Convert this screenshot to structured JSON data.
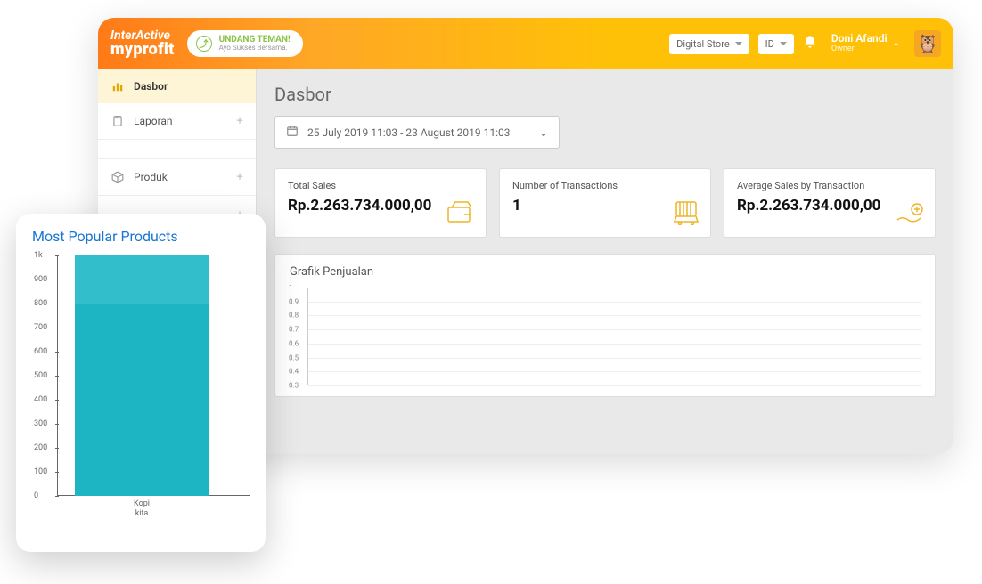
{
  "header": {
    "logo_top": "InterActive",
    "logo_bottom": "myprofit",
    "invite_title": "UNDANG TEMAN!",
    "invite_sub": "Ayo Sukses Bersama.",
    "store_select": "Digital Store",
    "lang_select": "ID",
    "user_name": "Doni Afandi",
    "user_role": "Owner"
  },
  "sidebar": {
    "items": [
      {
        "label": "Dasbor",
        "expandable": false,
        "active": true
      },
      {
        "label": "Laporan",
        "expandable": true,
        "active": false
      },
      {
        "label": "Produk",
        "expandable": true,
        "active": false
      },
      {
        "label": "",
        "expandable": true,
        "active": false
      },
      {
        "label": "",
        "expandable": true,
        "active": false
      },
      {
        "label": "",
        "expandable": true,
        "active": false
      }
    ]
  },
  "main": {
    "title": "Dasbor",
    "date_range": "25 July 2019 11:03 - 23 August 2019 11:03",
    "cards": [
      {
        "label": "Total Sales",
        "value": "Rp.2.263.734.000,00"
      },
      {
        "label": "Number of Transactions",
        "value": "1"
      },
      {
        "label": "Average Sales by Transaction",
        "value": "Rp.2.263.734.000,00"
      }
    ],
    "sales_chart_title": "Grafik Penjualan"
  },
  "popup": {
    "title": "Most Popular Products"
  },
  "chart_data": [
    {
      "type": "bar",
      "title": "Most Popular Products",
      "categories": [
        "Kopi kita"
      ],
      "values": [
        1000
      ],
      "ylim": [
        0,
        1000
      ],
      "yticks": [
        0,
        100,
        200,
        300,
        400,
        500,
        600,
        700,
        800,
        900,
        "1k"
      ],
      "xlabel": "",
      "ylabel": ""
    },
    {
      "type": "line",
      "title": "Grafik Penjualan",
      "x": [],
      "values": [],
      "ylim": [
        0,
        1
      ],
      "yticks": [
        0.3,
        0.4,
        0.5,
        0.6,
        0.7,
        0.8,
        0.9,
        1
      ],
      "xlabel": "",
      "ylabel": ""
    }
  ]
}
